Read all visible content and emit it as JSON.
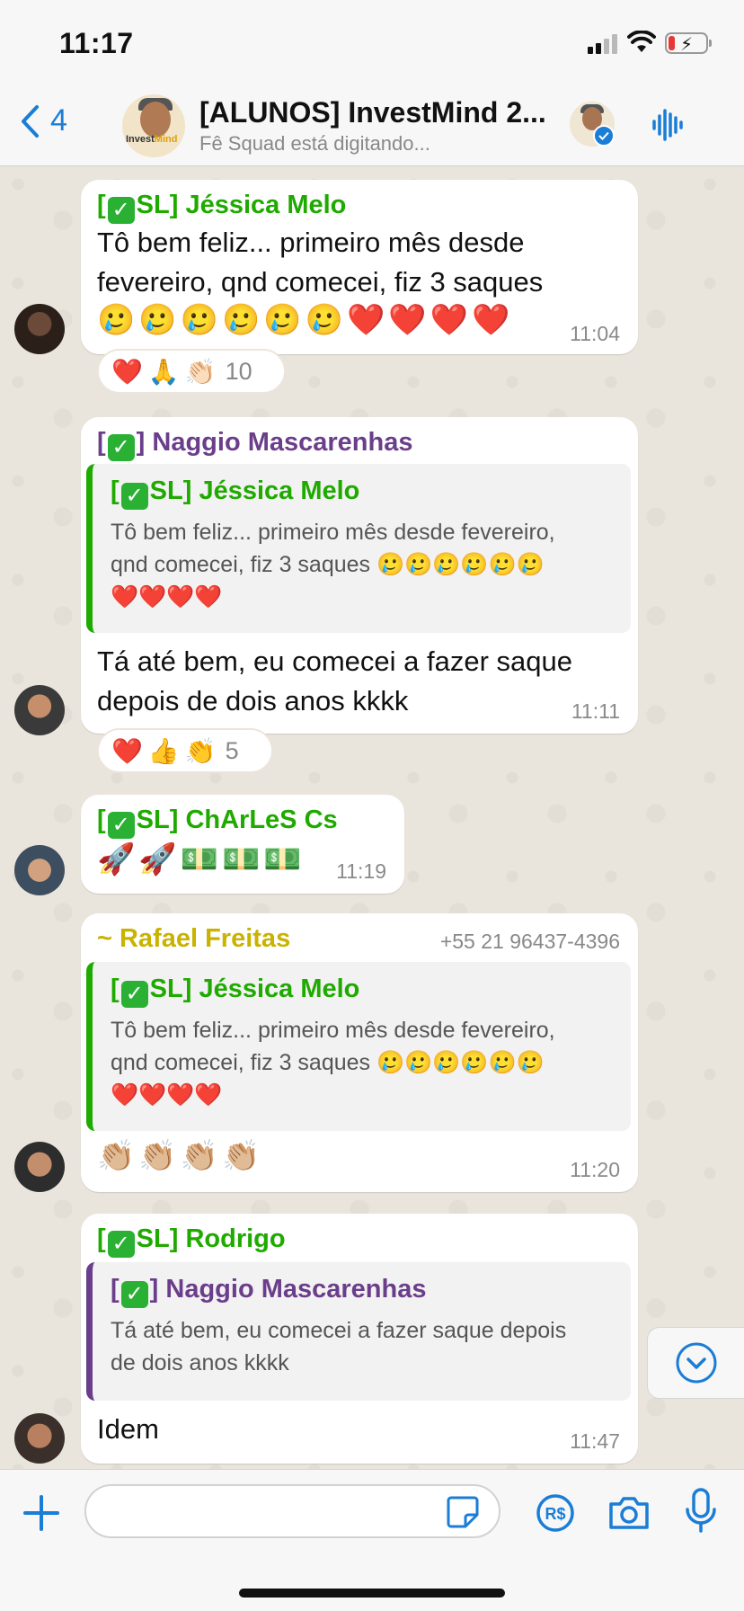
{
  "status": {
    "time": "11:17"
  },
  "header": {
    "back_count": "4",
    "title": "[ALUNOS] InvestMind 2...",
    "subtitle": "Fê Squad está digitando...",
    "logo_text_a": "Invest",
    "logo_text_b": "Mind"
  },
  "messages": [
    {
      "sender_prefix": "[",
      "sender_name": "SL] Jéssica Melo",
      "text_line1": "Tô bem feliz... primeiro mês desde",
      "text_line2": "fevereiro, qnd comecei, fiz 3 saques",
      "emojis": "🥲🥲🥲🥲🥲🥲❤️❤️❤️❤️",
      "time": "11:04",
      "reactions": "❤️🙏👏🏻",
      "reaction_count": "10"
    },
    {
      "sender_prefix": "[",
      "sender_name": "] Naggio Mascarenhas",
      "quote_sender_prefix": "[",
      "quote_sender": "SL] Jéssica Melo",
      "quote_line1": "Tô bem feliz... primeiro mês desde fevereiro,",
      "quote_line2": "qnd comecei, fiz 3 saques 🥲🥲🥲🥲🥲🥲",
      "quote_line3": "❤️❤️❤️❤️",
      "text_line1": "Tá até bem, eu comecei a fazer saque",
      "text_line2": "depois de dois anos kkkk",
      "time": "11:11",
      "reactions": "❤️👍👏",
      "reaction_count": "5"
    },
    {
      "sender_prefix": "[",
      "sender_name": "SL] ChArLeS Cs",
      "emojis": "🚀🚀💵💵💵",
      "time": "11:19"
    },
    {
      "sender_name": "~ Rafael Freitas",
      "phone": "+55 21 96437-4396",
      "quote_sender_prefix": "[",
      "quote_sender": "SL] Jéssica Melo",
      "quote_line1": "Tô bem feliz... primeiro mês desde fevereiro,",
      "quote_line2": "qnd comecei, fiz 3 saques 🥲🥲🥲🥲🥲🥲",
      "quote_line3": "❤️❤️❤️❤️",
      "emojis": "👏🏼👏🏼👏🏼👏🏼",
      "time": "11:20"
    },
    {
      "sender_prefix": "[",
      "sender_name": "SL] Rodrigo",
      "quote_sender_prefix": "[",
      "quote_sender": "] Naggio Mascarenhas",
      "quote_line1": "Tá até bem, eu comecei a fazer saque depois",
      "quote_line2": "de dois anos kkkk",
      "text_line1": "Idem",
      "time": "11:47"
    }
  ],
  "input": {
    "placeholder": ""
  },
  "colors": {
    "accent": "#1a7dd6",
    "sender_green": "#1faa00",
    "sender_purple": "#6a3e8a",
    "sender_yellow": "#c9b200"
  },
  "icons": [
    "chevron-left-icon",
    "audio-waveform-icon",
    "verified-check-icon",
    "chevron-down-icon",
    "plus-icon",
    "sticker-icon",
    "payment-icon",
    "camera-icon",
    "microphone-icon"
  ]
}
